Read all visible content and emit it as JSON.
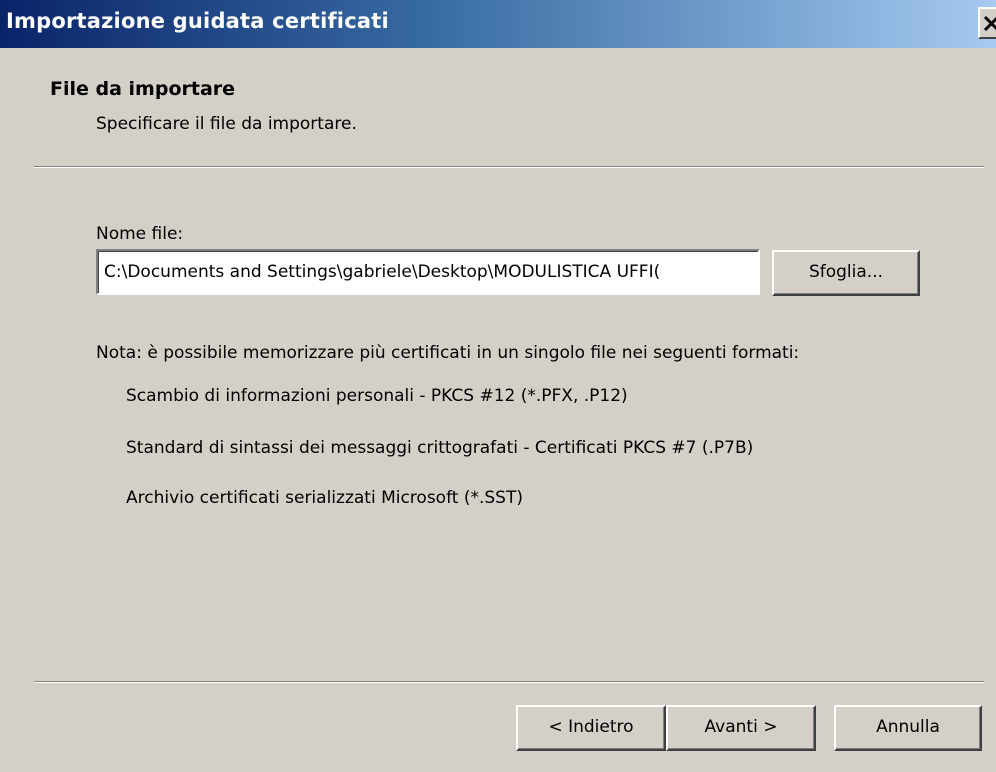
{
  "window": {
    "title": "Importazione guidata certificati",
    "close_glyph": "✕"
  },
  "header": {
    "title": "File da importare",
    "subtitle": "Specificare il file da importare."
  },
  "file": {
    "label": "Nome file:",
    "value": "C:\\Documents and Settings\\gabriele\\Desktop\\MODULISTICA UFFI(",
    "browse_label": "Sfoglia..."
  },
  "note": {
    "text": "Nota: è possibile memorizzare più certificati in un singolo file nei seguenti formati:",
    "formats": [
      "Scambio di informazioni personali - PKCS #12 (*.PFX, .P12)",
      "Standard di sintassi dei messaggi crittografati - Certificati PKCS #7 (.P7B)",
      "Archivio certificati serializzati Microsoft (*.SST)"
    ]
  },
  "footer": {
    "back_label": "< Indietro",
    "next_label": "Avanti >",
    "cancel_label": "Annulla"
  },
  "colors": {
    "titlebar_start": "#0a246a",
    "titlebar_end": "#a6caf0",
    "dialog_face": "#d4d0c8"
  }
}
